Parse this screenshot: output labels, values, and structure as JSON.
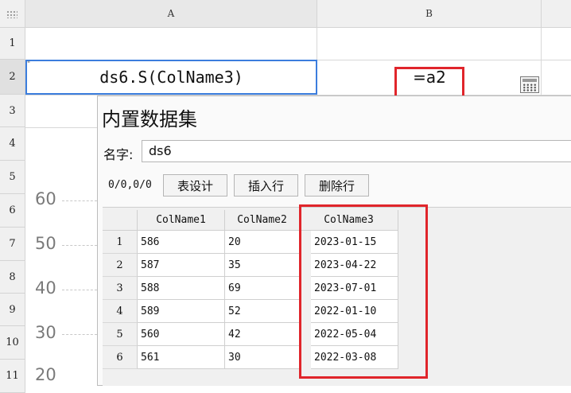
{
  "spreadsheet": {
    "columns": [
      "A",
      "B"
    ],
    "rows": [
      "1",
      "2",
      "3",
      "4",
      "5",
      "6",
      "7",
      "8",
      "9",
      "10",
      "11"
    ],
    "cell_a2": "ds6.S(ColName3)",
    "cell_b2": "=a2",
    "cell_a2_marker": "\"",
    "calculator_icon": "calculator-icon"
  },
  "background_chart": {
    "y_labels": [
      "60",
      "50",
      "40",
      "30",
      "20"
    ]
  },
  "dialog": {
    "title": "内置数据集",
    "name_label": "名字:",
    "name_value": "ds6",
    "page_indicator": "0/0,0/0",
    "buttons": {
      "table_design": "表设计",
      "insert_row": "插入行",
      "delete_row": "删除行"
    },
    "table": {
      "headers": [
        "ColName1",
        "ColName2",
        "ColName3"
      ],
      "rows": [
        {
          "n": "1",
          "c1": "586",
          "c2": "20",
          "c3": "2023-01-15"
        },
        {
          "n": "2",
          "c1": "587",
          "c2": "35",
          "c3": "2023-04-22"
        },
        {
          "n": "3",
          "c1": "588",
          "c2": "69",
          "c3": "2023-07-01"
        },
        {
          "n": "4",
          "c1": "589",
          "c2": "52",
          "c3": "2022-01-10"
        },
        {
          "n": "5",
          "c1": "560",
          "c2": "42",
          "c3": "2022-05-04"
        },
        {
          "n": "6",
          "c1": "561",
          "c2": "30",
          "c3": "2022-03-08"
        }
      ]
    }
  },
  "colors": {
    "selection_border": "#3b7ddd",
    "highlight_red": "#e0252b"
  }
}
